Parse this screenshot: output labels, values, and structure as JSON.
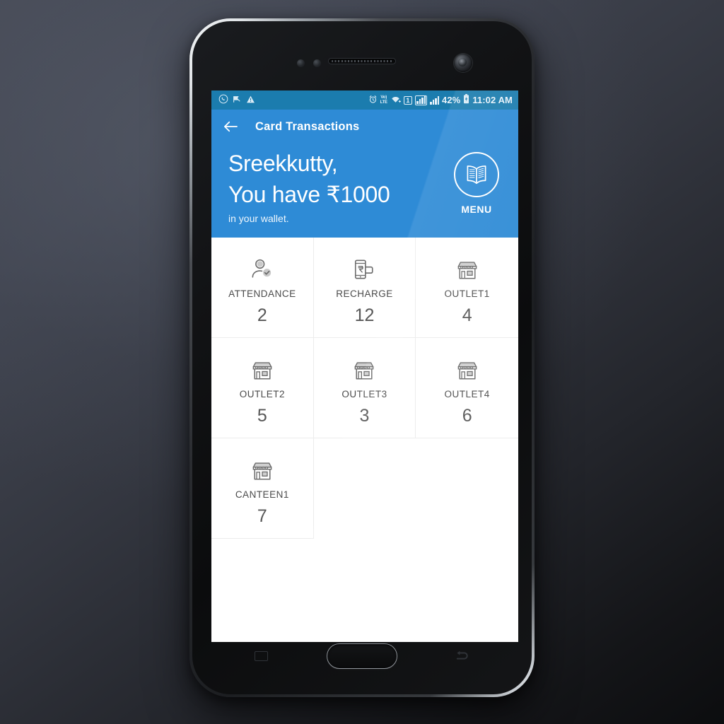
{
  "status_bar": {
    "left_icons": [
      {
        "name": "whatsapp-icon",
        "glyph": "◍"
      },
      {
        "name": "message-flag-icon",
        "glyph": "▶"
      },
      {
        "name": "warning-icon",
        "glyph": "⚠"
      }
    ],
    "alarm_icon": "⏰",
    "volte_top": "VoLTE",
    "volte_line1": "Vo)",
    "volte_line2": "LTE",
    "wifi_icon": "wifi-icon",
    "sim_label": "1",
    "battery_percent": "42%",
    "battery_icon": "battery-charging-icon",
    "time": "11:02 AM"
  },
  "app_bar": {
    "back_icon": "←",
    "title": "Card Transactions"
  },
  "hero": {
    "greeting_name": "Sreekkutty,",
    "balance_text": "You have ₹1000",
    "wallet_sub": "in your wallet.",
    "menu_label": "MENU",
    "menu_icon": "book-icon"
  },
  "colors": {
    "header_blue": "#2e8bd6",
    "status_blue": "#1b7cae",
    "tile_text": "#4a4a4a",
    "count_text": "#575757",
    "divider": "#ececec"
  },
  "grid": {
    "tiles": [
      {
        "label": "ATTENDANCE",
        "count": "2",
        "icon": "person-check-icon"
      },
      {
        "label": "RECHARGE",
        "count": "12",
        "icon": "phone-rupee-icon"
      },
      {
        "label": "OUTLET1",
        "count": "4",
        "icon": "store-icon"
      },
      {
        "label": "OUTLET2",
        "count": "5",
        "icon": "store-icon"
      },
      {
        "label": "OUTLET3",
        "count": "3",
        "icon": "store-icon"
      },
      {
        "label": "OUTLET4",
        "count": "6",
        "icon": "store-icon"
      },
      {
        "label": "CANTEEN1",
        "count": "7",
        "icon": "store-icon"
      }
    ]
  },
  "device_nav": {
    "recent_apps": "recent-apps-button",
    "home": "home-button",
    "back": "back-button"
  }
}
